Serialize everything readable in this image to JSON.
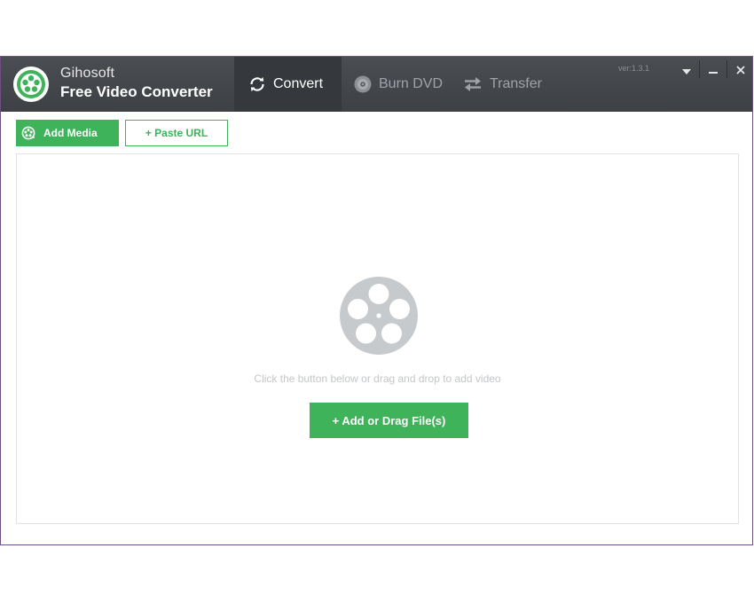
{
  "app": {
    "brand_line1": "Gihosoft",
    "brand_line2": "Free Video Converter",
    "version": "ver:1.3.1"
  },
  "tabs": [
    {
      "label": "Convert",
      "icon": "refresh-icon",
      "active": true
    },
    {
      "label": "Burn DVD",
      "icon": "disc-icon",
      "active": false
    },
    {
      "label": "Transfer",
      "icon": "transfer-arrows-icon",
      "active": false
    }
  ],
  "window_controls": {
    "menu_icon": "caret-down-icon",
    "minimize_icon": "minimize-icon",
    "close_icon": "close-icon"
  },
  "toolbar": {
    "add_media_label": "Add Media",
    "paste_url_label": "+ Paste URL"
  },
  "dropzone": {
    "icon": "film-reel-icon",
    "hint": "Click the button below or drag and drop to add video",
    "add_button_label": "+ Add or Drag File(s)"
  },
  "colors": {
    "accent_green": "#3fb35a",
    "titlebar": "#43464a",
    "active_tab": "#35383c",
    "reel_gray": "#c6cacd"
  }
}
